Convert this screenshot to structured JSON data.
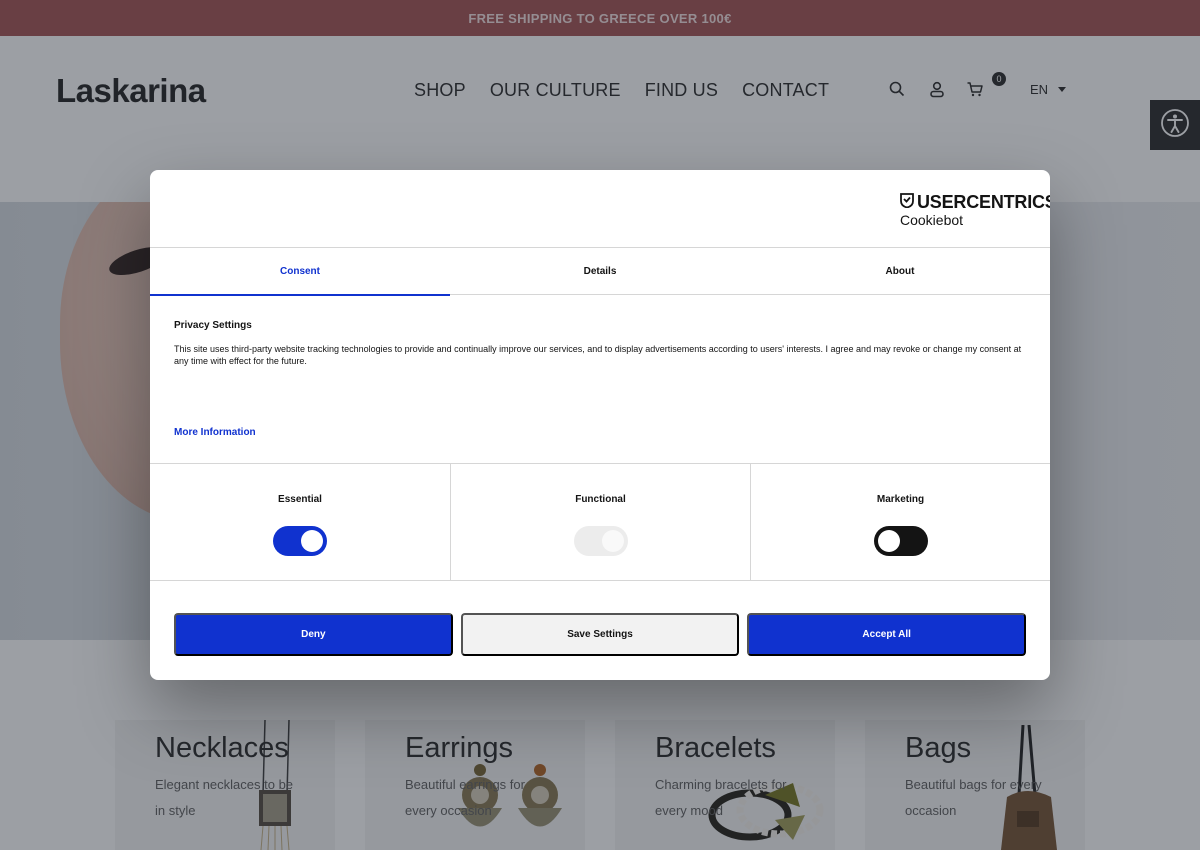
{
  "promo": {
    "text": "FREE SHIPPING TO GREECE OVER 100€"
  },
  "header": {
    "logo": "Laskarina",
    "nav": [
      "SHOP",
      "OUR CULTURE",
      "FIND US",
      "CONTACT"
    ],
    "cart_count": "0",
    "language": "EN",
    "icons": [
      "search-icon",
      "user-icon",
      "cart-icon",
      "accessibility-icon"
    ]
  },
  "categories": [
    {
      "title": "Necklaces",
      "desc": "Elegant necklaces to be in style"
    },
    {
      "title": "Earrings",
      "desc": "Beautiful earrings for every occasion"
    },
    {
      "title": "Bracelets",
      "desc": "Charming bracelets for every mood"
    },
    {
      "title": "Bags",
      "desc": "Beautiful bags for every occasion"
    }
  ],
  "consent": {
    "brand": "USERCENTRICS",
    "brand_sub": "Cookiebot",
    "tabs": [
      "Consent",
      "Details",
      "About"
    ],
    "active_tab": "Consent",
    "privacy_title": "Privacy Settings",
    "privacy_text": "This site uses third-party website tracking technologies to provide and continually improve our services, and to display advertisements according to users' interests. I agree and may revoke or change my consent at any time with effect for the future.",
    "more_info": "More Information",
    "toggles": [
      {
        "label": "Essential",
        "state": "on-locked"
      },
      {
        "label": "Functional",
        "state": "disabled"
      },
      {
        "label": "Marketing",
        "state": "off"
      }
    ],
    "buttons": {
      "deny": "Deny",
      "save": "Save Settings",
      "accept": "Accept All"
    }
  },
  "colors": {
    "accent": "#1032cf",
    "promo_bg": "#a85a5a",
    "text_dark": "#141414"
  }
}
